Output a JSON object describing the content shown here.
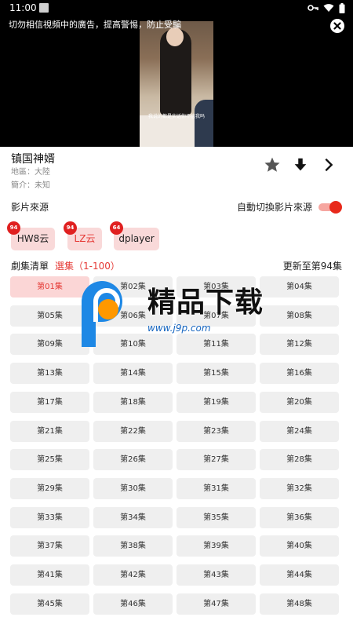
{
  "status_bar": {
    "time": "11:00"
  },
  "video": {
    "warning": "切勿相信視頻中的廣告，提高警惕，防止受騙",
    "subtitle": "我说的都是实话你不信我吗"
  },
  "show": {
    "title": "镇国神婿",
    "region": "地區：大陸",
    "intro": "簡介：未知"
  },
  "sources": {
    "label": "影片來源",
    "auto_switch_label": "自動切換影片來源",
    "auto_switch_on": true,
    "items": [
      {
        "name": "HW8云",
        "badge": "94",
        "active": false
      },
      {
        "name": "LZ云",
        "badge": "94",
        "active": true
      },
      {
        "name": "dplayer",
        "badge": "64",
        "active": false
      }
    ]
  },
  "episodes": {
    "label": "劇集清單",
    "select_label": "選集（1-100）",
    "update_text": "更新至第94集",
    "items": [
      "第01集",
      "第02集",
      "第03集",
      "第04集",
      "第05集",
      "第06集",
      "第07集",
      "第08集",
      "第09集",
      "第10集",
      "第11集",
      "第12集",
      "第13集",
      "第14集",
      "第15集",
      "第16集",
      "第17集",
      "第18集",
      "第19集",
      "第20集",
      "第21集",
      "第22集",
      "第23集",
      "第24集",
      "第25集",
      "第26集",
      "第27集",
      "第28集",
      "第29集",
      "第30集",
      "第31集",
      "第32集",
      "第33集",
      "第34集",
      "第35集",
      "第36集",
      "第37集",
      "第38集",
      "第39集",
      "第40集",
      "第41集",
      "第42集",
      "第43集",
      "第44集",
      "第45集",
      "第46集",
      "第47集",
      "第48集"
    ],
    "active_index": 0
  },
  "watermark": {
    "text": "精品下载",
    "url": "www.j9p.com"
  },
  "colors": {
    "accent": "#e53935",
    "chip_bg": "#f9d9d9",
    "episode_bg": "#efefef"
  },
  "icons": {
    "favorite": "star-icon",
    "download": "download-arrow-icon",
    "next": "chevron-right-icon",
    "close": "close-icon"
  }
}
